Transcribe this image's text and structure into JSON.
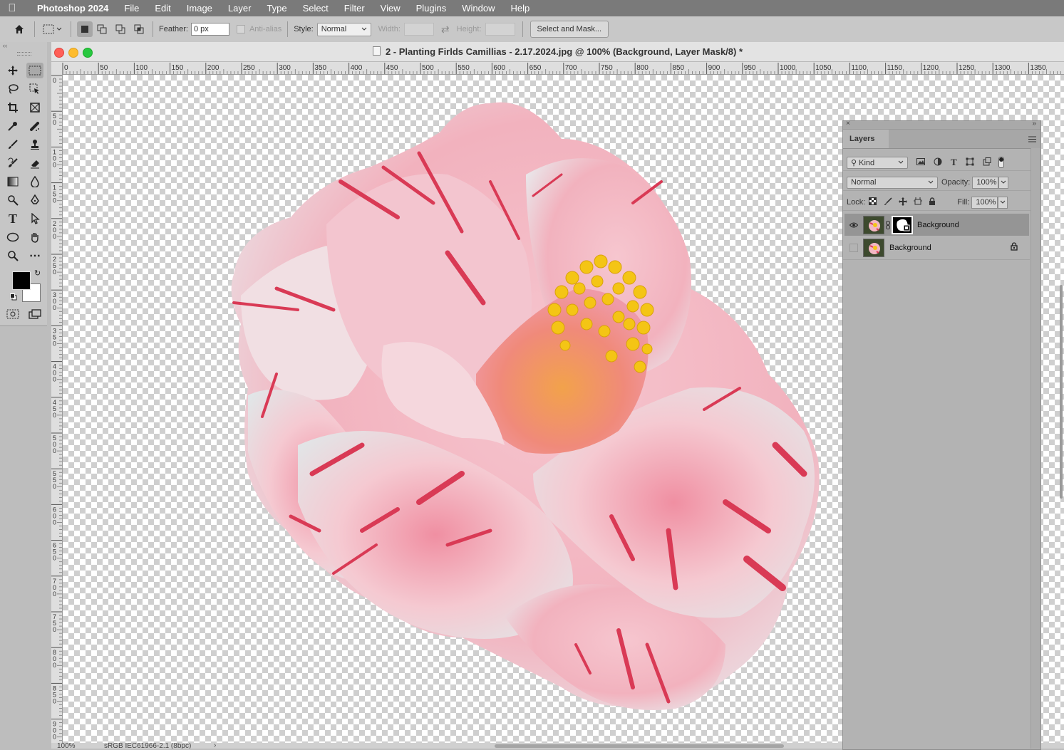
{
  "menubar": {
    "app_name": "Photoshop 2024",
    "items": [
      "File",
      "Edit",
      "Image",
      "Layer",
      "Type",
      "Select",
      "Filter",
      "View",
      "Plugins",
      "Window",
      "Help"
    ]
  },
  "options_bar": {
    "feather_label": "Feather:",
    "feather_value": "0 px",
    "anti_alias_label": "Anti-alias",
    "style_label": "Style:",
    "style_value": "Normal",
    "width_label": "Width:",
    "height_label": "Height:",
    "select_mask_button": "Select and Mask..."
  },
  "document": {
    "title": "2 - Planting Firlds Camillias - 2.17.2024.jpg @ 100% (Background, Layer Mask/8) *"
  },
  "ruler": {
    "h_labels": [
      "0",
      "50",
      "100",
      "150",
      "200",
      "250",
      "300",
      "350",
      "400",
      "450",
      "500",
      "550",
      "600",
      "650",
      "700",
      "750",
      "800",
      "850",
      "900",
      "950",
      "1000",
      "1050",
      "1100",
      "1150",
      "1200",
      "1250",
      "1300",
      "1350"
    ],
    "v_labels": [
      "0",
      "50",
      "100",
      "150",
      "200",
      "250",
      "300",
      "350",
      "400",
      "450",
      "500",
      "550",
      "600",
      "650",
      "700",
      "750",
      "800",
      "850",
      "900"
    ]
  },
  "status": {
    "zoom": "100%",
    "profile": "sRGB IEC61966-2.1 (8bpc)",
    "arrow": "›"
  },
  "layers_panel": {
    "tab": "Layers",
    "filter_kind": "Kind",
    "blend_mode": "Normal",
    "opacity_label": "Opacity:",
    "opacity_value": "100%",
    "lock_label": "Lock:",
    "fill_label": "Fill:",
    "fill_value": "100%",
    "layers": [
      {
        "name": "Background",
        "visible": true,
        "selected": true,
        "has_mask": true,
        "locked": false
      },
      {
        "name": "Background",
        "visible": false,
        "selected": false,
        "has_mask": false,
        "locked": true
      }
    ]
  },
  "colors": {
    "menubar_bg": "#7a7a7a",
    "panel_bg": "#b3b3b3",
    "selected_layer": "#959595",
    "foreground_swatch": "#000000",
    "background_swatch": "#ffffff"
  }
}
